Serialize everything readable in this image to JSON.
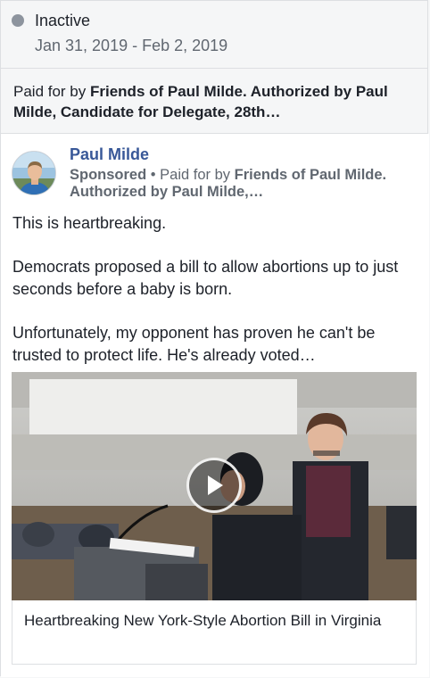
{
  "status": {
    "label": "Inactive",
    "dates": "Jan 31, 2019 - Feb 2, 2019"
  },
  "disclaimer": {
    "prefix": "Paid for by ",
    "sponsor": "Friends of Paul Milde. Authorized by Paul Milde, Candidate for Delegate, 28th…"
  },
  "post": {
    "page_name": "Paul Milde",
    "sponsored_label": "Sponsored",
    "separator": " • ",
    "paid_prefix": "Paid for by ",
    "paid_sponsor": "Friends of Paul Milde. Authorized by Paul Milde,…",
    "paragraphs": [
      "This is heartbreaking.",
      "Democrats proposed a bill to allow abortions up to just seconds before a baby is born.",
      "Unfortunately, my opponent has proven he can't be trusted to protect life. He's already voted…"
    ],
    "link_title": "Heartbreaking New York-Style Abortion Bill in Virginia"
  },
  "colors": {
    "page_name": "#385898",
    "inactive_dot": "#8d949e",
    "secondary_text": "#606770"
  },
  "icons": {
    "play": "play-icon",
    "status": "status-dot-icon"
  }
}
